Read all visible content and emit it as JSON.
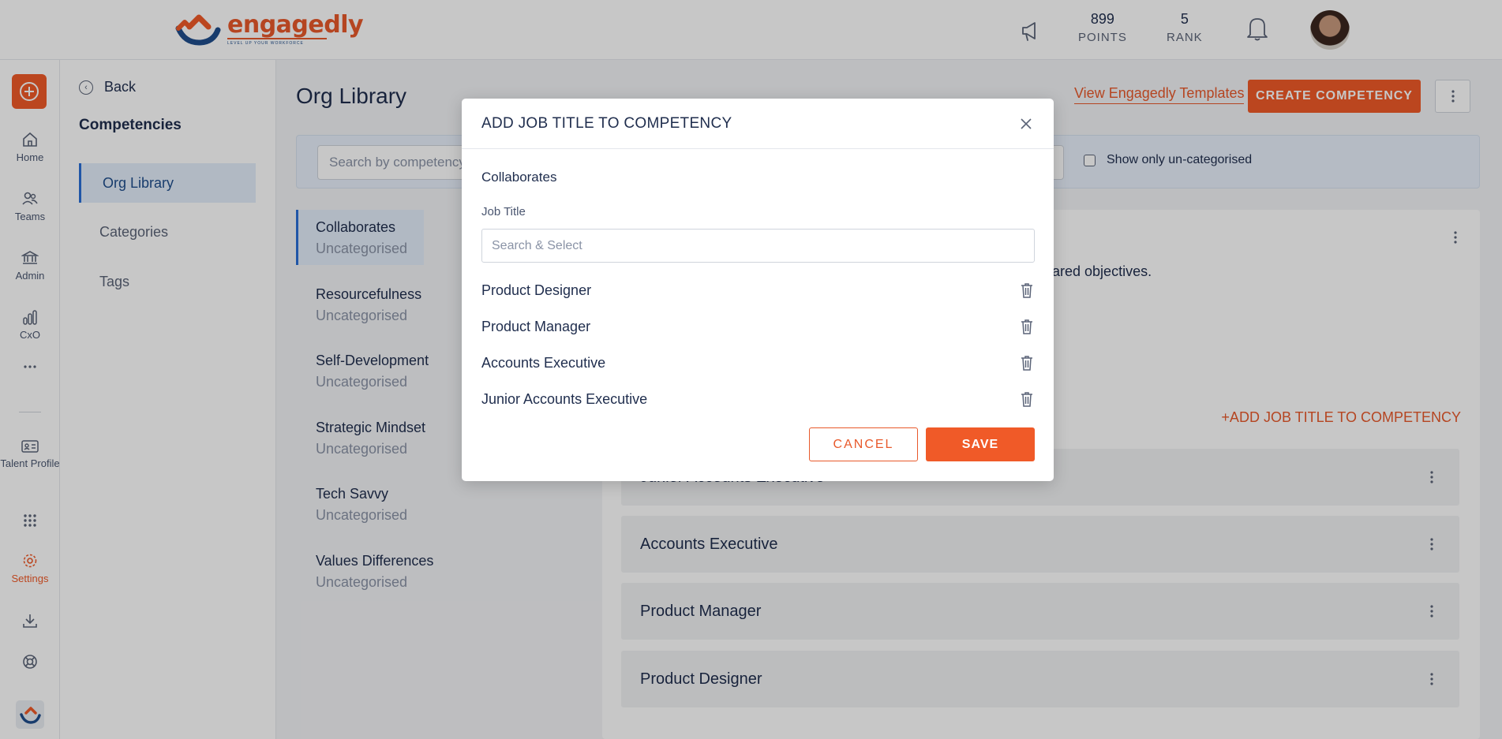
{
  "header": {
    "logo_text": "engagedly",
    "logo_tagline": "LEVEL UP YOUR WORKFORCE",
    "points_value": "899",
    "points_label": "POINTS",
    "rank_value": "5",
    "rank_label": "RANK"
  },
  "rail": {
    "items": [
      {
        "label": "Home",
        "icon": "home-icon"
      },
      {
        "label": "Teams",
        "icon": "teams-icon"
      },
      {
        "label": "Admin",
        "icon": "bank-icon"
      },
      {
        "label": "CxO",
        "icon": "bar-chart-icon"
      },
      {
        "label": "Talent Profile",
        "icon": "id-card-icon"
      },
      {
        "label": "Settings",
        "icon": "gear-icon"
      }
    ]
  },
  "subnav": {
    "back_label": "Back",
    "title": "Competencies",
    "items": [
      {
        "label": "Org Library",
        "active": true
      },
      {
        "label": "Categories",
        "active": false
      },
      {
        "label": "Tags",
        "active": false
      }
    ]
  },
  "main": {
    "title": "Org Library",
    "view_templates_label": "View Engagedly Templates",
    "create_label": "CREATE COMPETENCY",
    "search_placeholder": "Search by competency, c",
    "show_uncategorised_label": "Show only un-categorised",
    "competencies": [
      {
        "name": "Collaborates",
        "category": "Uncategorised"
      },
      {
        "name": "Resourcefulness",
        "category": "Uncategorised"
      },
      {
        "name": "Self-Development",
        "category": "Uncategorised"
      },
      {
        "name": "Strategic Mindset",
        "category": "Uncategorised"
      },
      {
        "name": "Tech Savvy",
        "category": "Uncategorised"
      },
      {
        "name": "Values Differences",
        "category": "Uncategorised"
      }
    ],
    "detail": {
      "description_fragment": "hared objectives.",
      "add_job_title_label": "+ADD JOB TITLE TO COMPETENCY",
      "job_titles": [
        "Junior Accounts Executive",
        "Accounts Executive",
        "Product Manager",
        "Product Designer"
      ]
    }
  },
  "modal": {
    "title": "ADD JOB TITLE TO COMPETENCY",
    "competency_name": "Collaborates",
    "job_title_label": "Job Title",
    "search_placeholder": "Search & Select",
    "selected_titles": [
      "Product Designer",
      "Product Manager",
      "Accounts Executive",
      "Junior Accounts Executive"
    ],
    "cancel_label": "CANCEL",
    "save_label": "SAVE"
  },
  "colors": {
    "accent": "#f05a28",
    "brand_blue": "#1f4e8c",
    "active_blue": "#2a6fd6"
  }
}
